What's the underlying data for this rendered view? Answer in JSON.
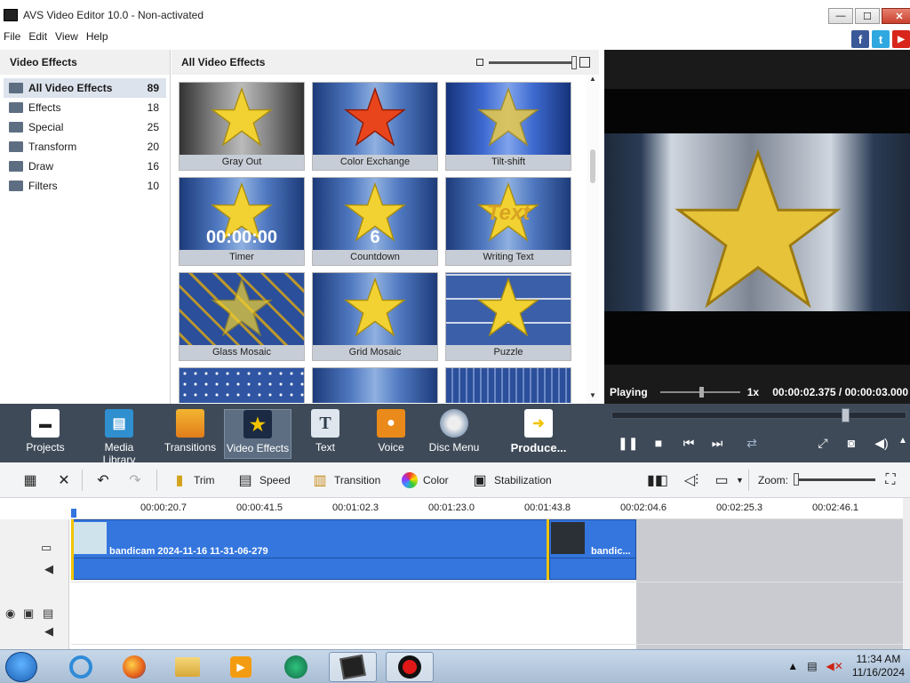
{
  "window": {
    "title": "AVS Video Editor 10.0 - Non-activated",
    "min": "—",
    "max": "☐",
    "close": "✕"
  },
  "social": {
    "facebook": "f",
    "twitter": "t",
    "youtube": "▶"
  },
  "menu": [
    "File",
    "Edit",
    "View",
    "Help"
  ],
  "left_panel": {
    "title": "Video Effects",
    "categories": [
      {
        "label": "All Video Effects",
        "count": "89"
      },
      {
        "label": "Effects",
        "count": "18"
      },
      {
        "label": "Special",
        "count": "25"
      },
      {
        "label": "Transform",
        "count": "20"
      },
      {
        "label": "Draw",
        "count": "16"
      },
      {
        "label": "Filters",
        "count": "10"
      }
    ]
  },
  "gallery": {
    "title": "All Video Effects",
    "tiles": [
      {
        "label": "Gray Out",
        "overlay": ""
      },
      {
        "label": "Color Exchange",
        "overlay": ""
      },
      {
        "label": "Tilt-shift",
        "overlay": ""
      },
      {
        "label": "Timer",
        "overlay": "00:00:00"
      },
      {
        "label": "Countdown",
        "overlay": "6"
      },
      {
        "label": "Writing Text",
        "overlay": "Text"
      },
      {
        "label": "Glass Mosaic",
        "overlay": ""
      },
      {
        "label": "Grid Mosaic",
        "overlay": ""
      },
      {
        "label": "Puzzle",
        "overlay": ""
      }
    ]
  },
  "preview": {
    "state": "Playing",
    "speed": "1x",
    "time": "00:00:02.375 / 00:00:03.000"
  },
  "toolbar": {
    "items": [
      "Projects",
      "Media Library",
      "Transitions",
      "Video Effects",
      "Text",
      "Voice",
      "Disc Menu",
      "Produce..."
    ],
    "selected": "Video Effects"
  },
  "edit_tools": {
    "trim": "Trim",
    "speed": "Speed",
    "transition": "Transition",
    "color": "Color",
    "stabilization": "Stabilization",
    "zoom": "Zoom:"
  },
  "timeline": {
    "ticks": [
      "00:00:20.7",
      "00:00:41.5",
      "00:01:02.3",
      "00:01:23.0",
      "00:01:43.8",
      "00:02:04.6",
      "00:02:25.3",
      "00:02:46.1"
    ],
    "clips": [
      {
        "name": "bandicam 2024-11-16 11-31-06-279"
      },
      {
        "name": "bandic..."
      }
    ]
  },
  "taskbar": {
    "time": "11:34 AM",
    "date": "11/16/2024"
  },
  "colors": {
    "toolbar": "#3e4a58",
    "clip": "#3476de",
    "accent_yellow": "#f2c400"
  }
}
